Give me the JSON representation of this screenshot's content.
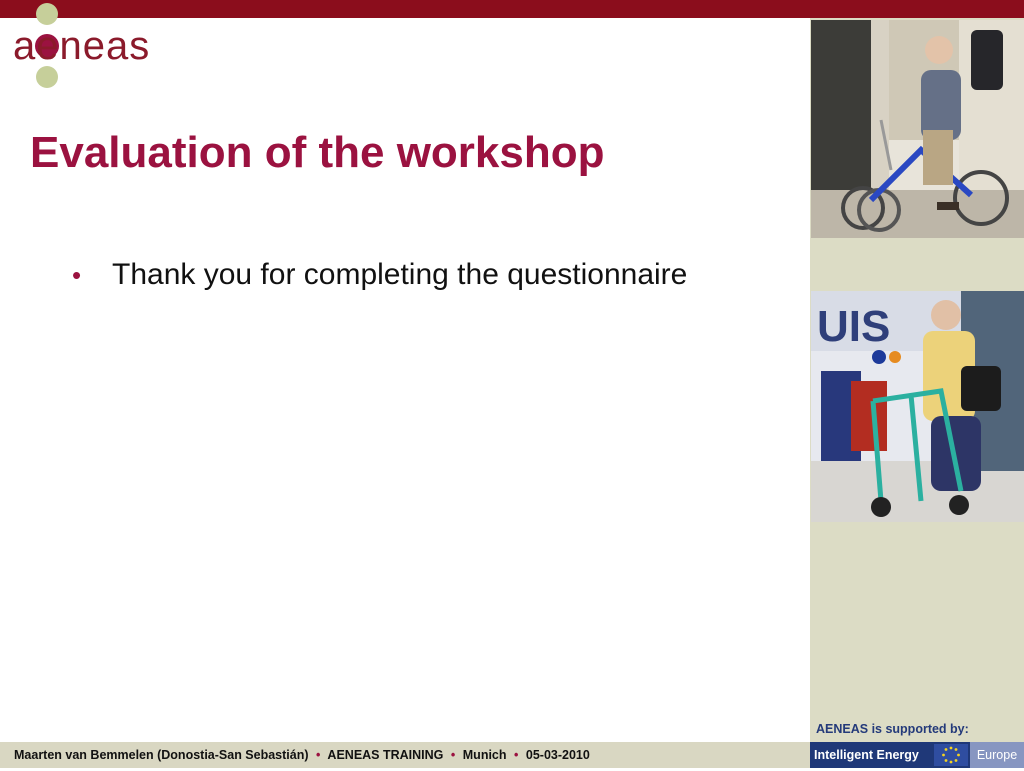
{
  "logo": {
    "text": "aeneas"
  },
  "slide": {
    "title": "Evaluation of the workshop",
    "bullets": [
      "Thank you for completing the questionnaire"
    ]
  },
  "sidebar": {
    "photos": [
      {
        "name": "man-on-tricycle-photo"
      },
      {
        "name": "woman-with-rollator-photo"
      }
    ],
    "support_label": "AENEAS is supported by:"
  },
  "footer": {
    "author": "Maarten van Bemmelen (Donostia-San Sebastián)",
    "event": "AENEAS TRAINING",
    "city": "Munich",
    "date": "05-03-2010",
    "separator": "•"
  },
  "sponsor": {
    "left": "Intelligent Energy",
    "right": "Europe"
  },
  "colors": {
    "accent": "#9b1240",
    "top_bar": "#8b0d1c",
    "sidebar_bg": "#dcdcc5",
    "footer_bg": "#d9d7c2",
    "sponsor_blue": "#1f3878"
  }
}
